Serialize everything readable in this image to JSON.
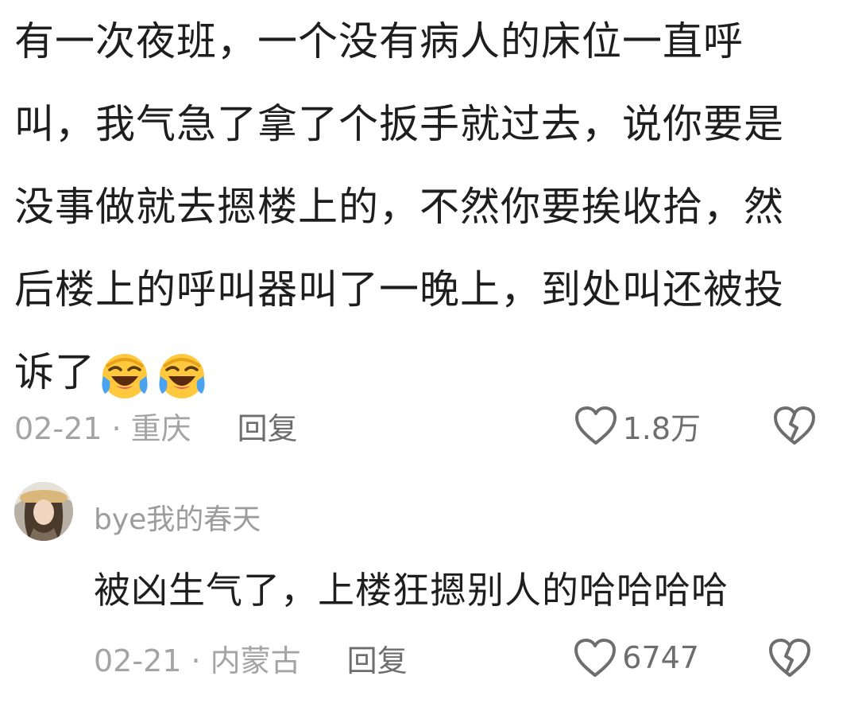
{
  "main_comment": {
    "lines": [
      "有一次夜班，一个没有病人的床位一直呼",
      "叫，我气急了拿了个扳手就过去，说你要是",
      "没事做就去摁楼上的，不然你要挨收拾，然",
      "后楼上的呼叫器叫了一晚上，到处叫还被投",
      "诉了"
    ],
    "emojis": [
      "laughing-crying-emoji",
      "laughing-crying-emoji"
    ],
    "date_location": "02-21 · 重庆",
    "reply_label": "回复",
    "likes": "1.8万"
  },
  "reply": {
    "username": "bye我的春天",
    "text": "被凶生气了，上楼狂摁别人的哈哈哈哈",
    "date_location": "02-21 · 内蒙古",
    "reply_label": "回复",
    "likes": "6747"
  },
  "icons": {
    "like": "heart-outline-icon",
    "dislike": "broken-heart-icon"
  },
  "colors": {
    "text": "#1e1e1e",
    "meta": "#a4a4a4",
    "action": "#6e6e6e",
    "emoji_yellow": "#ffc83d",
    "emoji_tear": "#4aa3f0"
  }
}
